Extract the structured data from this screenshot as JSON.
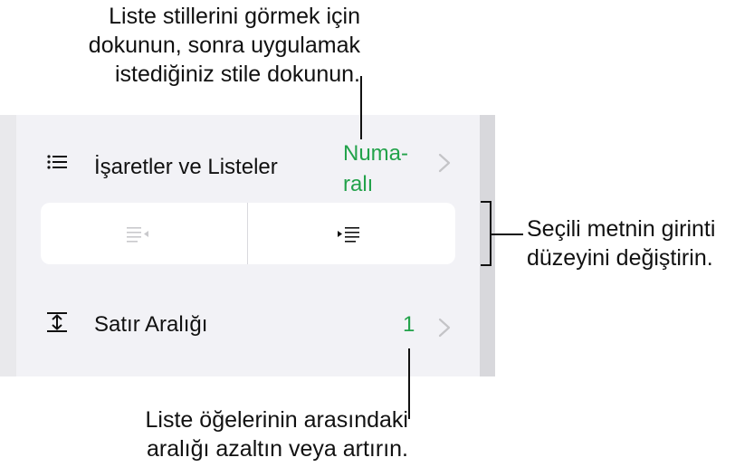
{
  "callouts": {
    "top": [
      "Liste stillerini görmek için",
      "dokunun, sonra uygulamak",
      "istediğiniz stile dokunun."
    ],
    "right": [
      "Seçili metnin girinti",
      "düzeyini değiştirin."
    ],
    "bottom": [
      "Liste öğelerinin arasındaki",
      "aralığı azaltın veya artırın."
    ]
  },
  "panel": {
    "lists_row": {
      "label": "İşaretler ve Listeler",
      "value_line1": "Numa-",
      "value_line2": "ralı",
      "icon": "list-bullets-icon"
    },
    "indent": {
      "decrease_icon": "decrease-indent-icon",
      "increase_icon": "increase-indent-icon"
    },
    "spacing_row": {
      "label": "Satır Aralığı",
      "value": "1",
      "icon": "line-spacing-icon"
    }
  },
  "colors": {
    "accent": "#22a24a",
    "panel_bg": "#f2f2f6",
    "chevron": "#c4c4c7"
  }
}
